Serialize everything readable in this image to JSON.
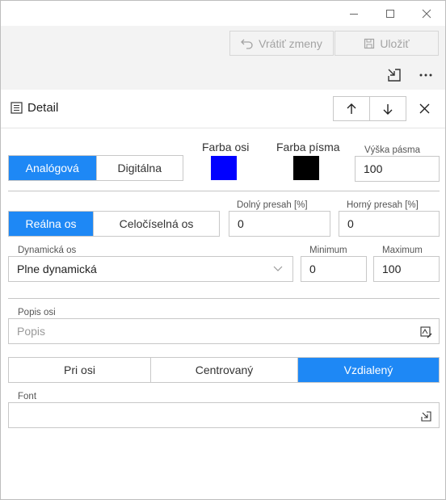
{
  "window": {
    "controls": [
      "minimize-icon",
      "maximize-icon",
      "close-icon"
    ]
  },
  "toolbar": {
    "revert_label": "Vrátiť zmeny",
    "save_label": "Uložiť"
  },
  "header": {
    "title": "Detail"
  },
  "axis_type": {
    "options": [
      "Analógová",
      "Digitálna"
    ],
    "selected": "Analógová"
  },
  "colors": {
    "axis_color_label": "Farba osi",
    "axis_color": "#0000ff",
    "font_color_label": "Farba písma",
    "font_color": "#000000",
    "accent": "#1e88f5"
  },
  "band_height": {
    "label": "Výška pásma",
    "value": "100"
  },
  "scale_type": {
    "options": [
      "Reálna os",
      "Celočíselná os"
    ],
    "selected": "Reálna os"
  },
  "lower_overflow": {
    "label": "Dolný presah [%]",
    "value": "0"
  },
  "upper_overflow": {
    "label": "Horný presah [%]",
    "value": "0"
  },
  "dynamic_axis": {
    "label": "Dynamická os",
    "value": "Plne dynamická"
  },
  "minimum": {
    "label": "Minimum",
    "value": "0"
  },
  "maximum": {
    "label": "Maximum",
    "value": "100"
  },
  "axis_description": {
    "label": "Popis osi",
    "placeholder": "Popis"
  },
  "label_position": {
    "options": [
      "Pri osi",
      "Centrovaný",
      "Vzdialený"
    ],
    "selected": "Vzdialený"
  },
  "font": {
    "label": "Font",
    "value": ""
  }
}
